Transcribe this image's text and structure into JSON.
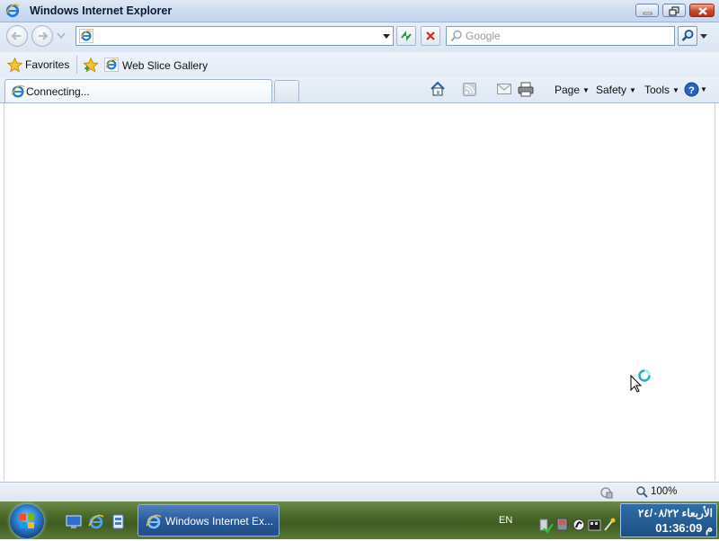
{
  "window": {
    "title": "Windows Internet Explorer"
  },
  "nav": {
    "address_value": "",
    "search_placeholder": "Google"
  },
  "favorites_bar": {
    "favorites_label": "Favorites",
    "items": [
      {
        "label": "Web Slice Gallery"
      }
    ]
  },
  "tabs": [
    {
      "label": "Connecting..."
    }
  ],
  "command_bar": {
    "page_label": "Page",
    "safety_label": "Safety",
    "tools_label": "Tools"
  },
  "status_bar": {
    "zoom": "100%"
  },
  "taskbar": {
    "active_task_label": "Windows Internet Ex...",
    "language": "EN",
    "clock_date": "الأربعاء ٢٤/٠٨/٢٢",
    "clock_time": "01:36:09 م"
  },
  "icons": [
    "ie-icon",
    "back-icon",
    "forward-icon",
    "refresh-icon",
    "stop-icon",
    "search-icon",
    "star-icon",
    "add-favorite-icon",
    "home-icon",
    "feeds-icon",
    "mail-icon",
    "print-icon",
    "help-icon",
    "protected-mode-icon",
    "zoom-icon",
    "busy-cursor-icon",
    "show-desktop-icon",
    "switch-windows-icon"
  ]
}
